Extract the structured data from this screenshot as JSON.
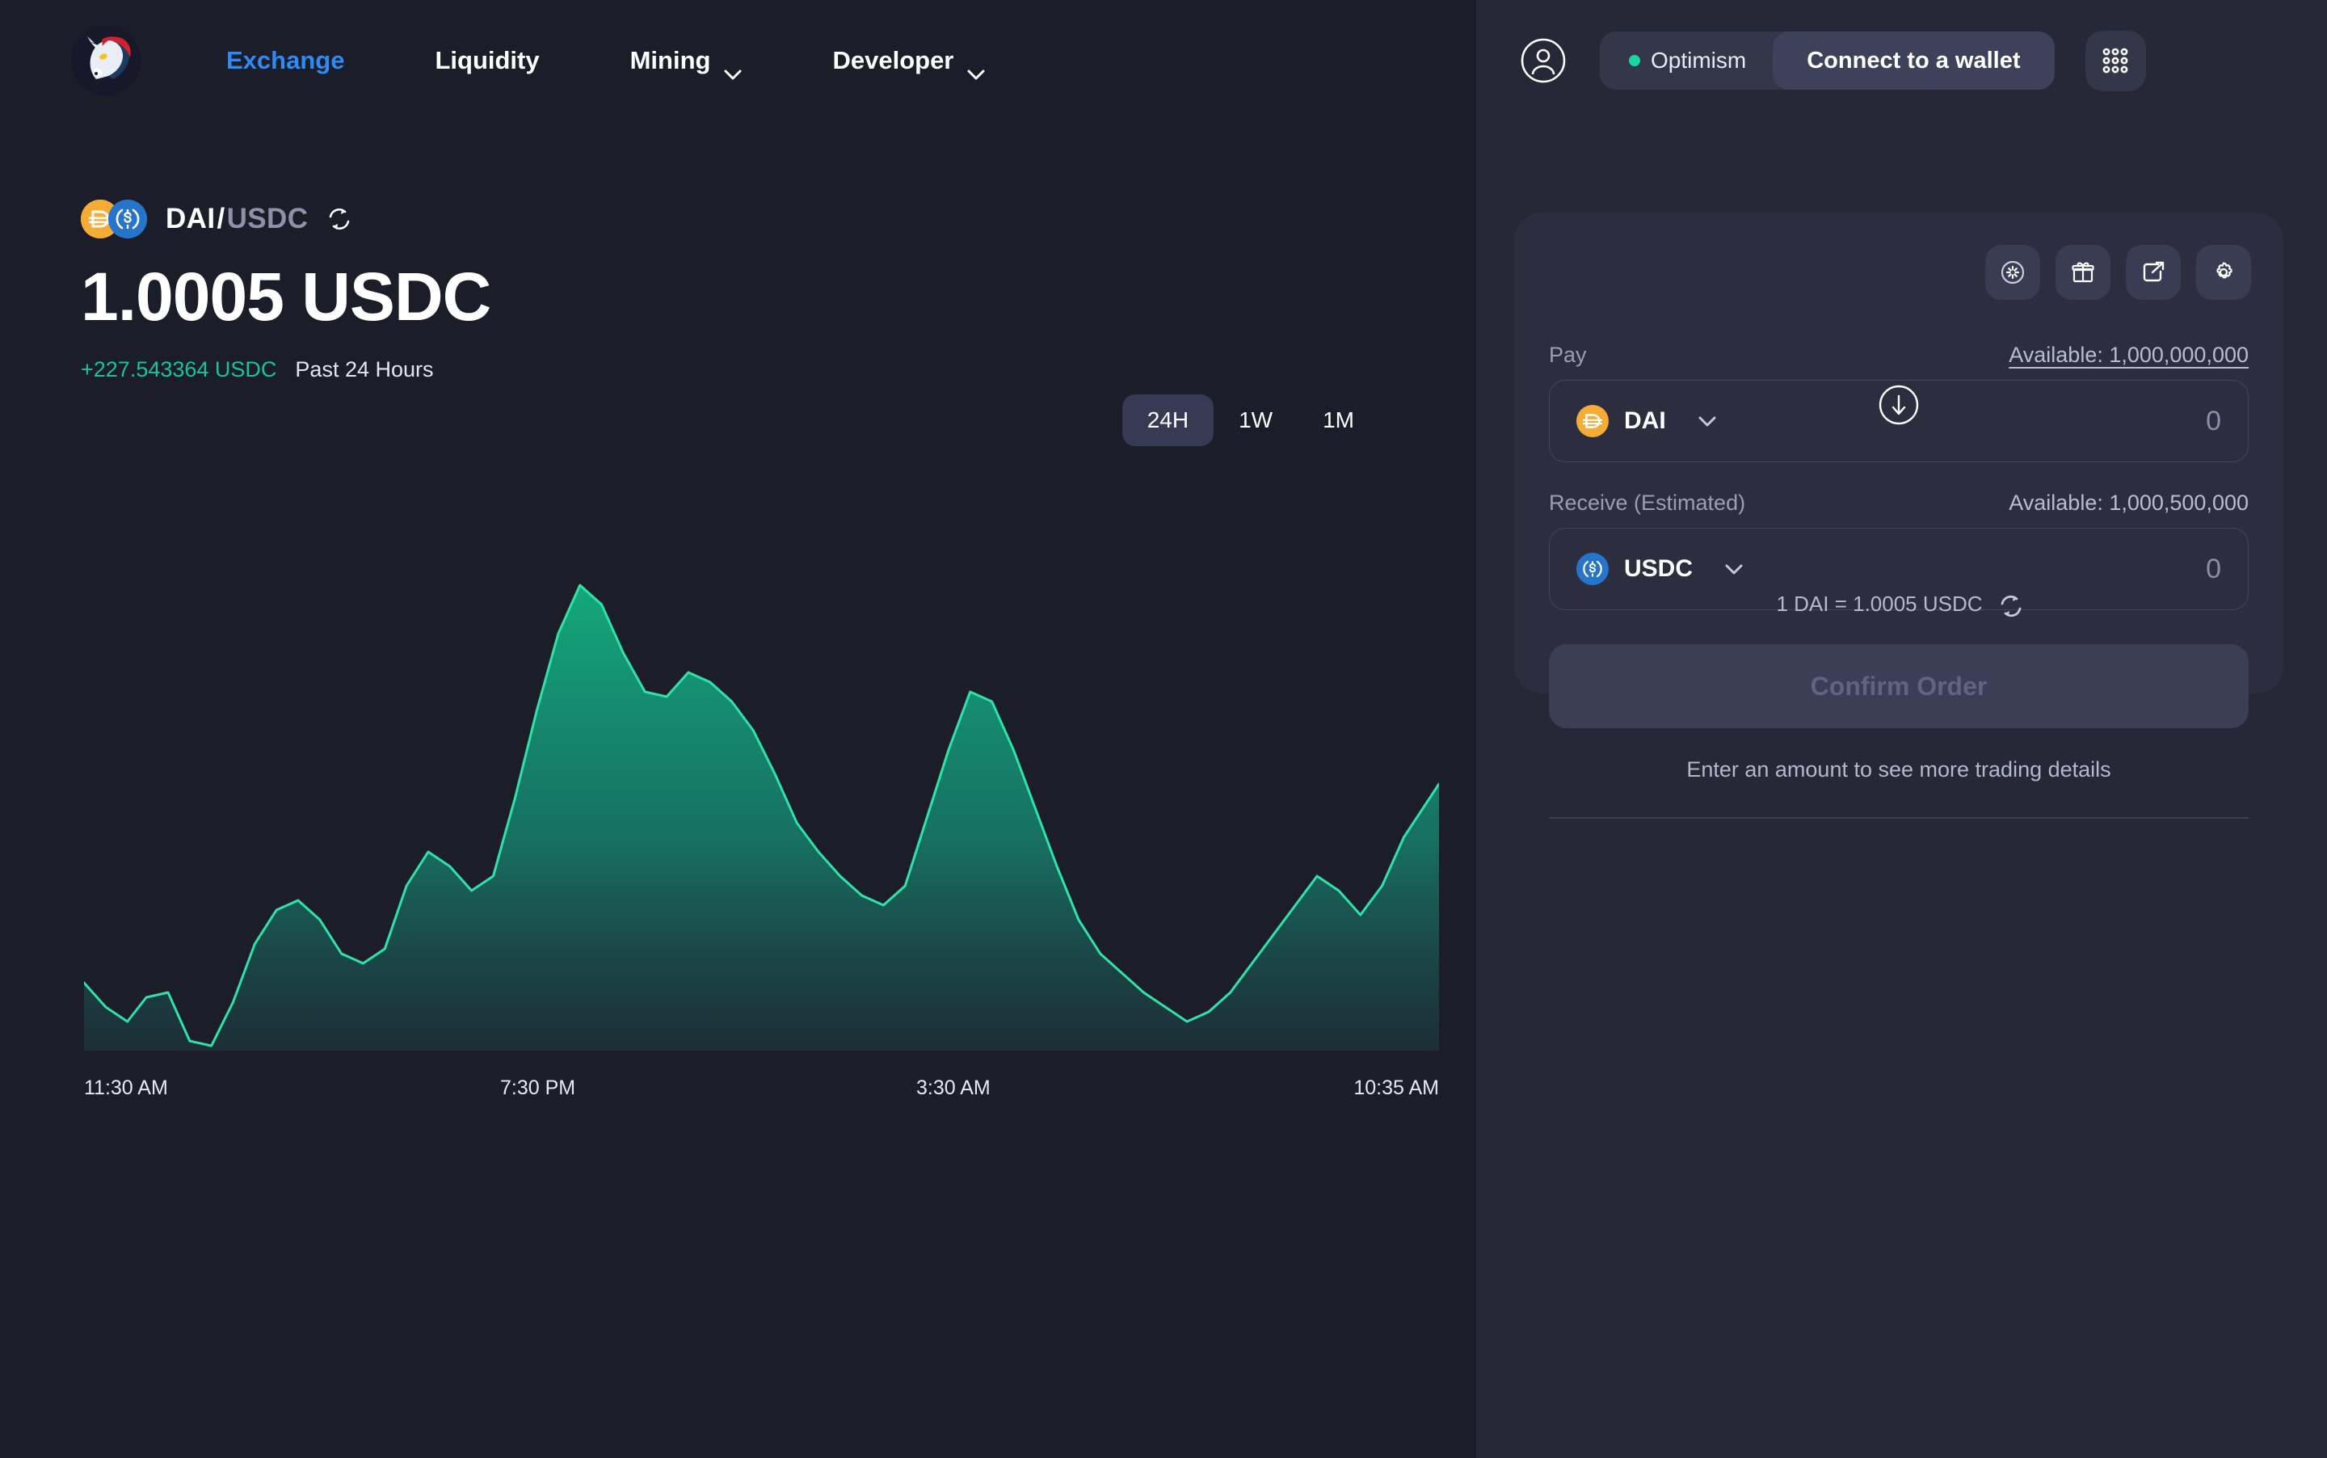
{
  "nav": {
    "logo_icon": "unicorn-logo-icon",
    "items": [
      {
        "label": "Exchange",
        "active": true,
        "has_caret": false,
        "icon": ""
      },
      {
        "label": "Liquidity",
        "active": false,
        "has_caret": false,
        "icon": ""
      },
      {
        "label": "Mining",
        "active": false,
        "has_caret": true,
        "icon": "chevron-down-icon"
      },
      {
        "label": "Developer",
        "active": false,
        "has_caret": true,
        "icon": "chevron-down-icon"
      }
    ]
  },
  "wallet": {
    "avatar_icon": "user-avatar-icon",
    "network": "Optimism",
    "network_dot_color": "#19d69e",
    "connect_label": "Connect to a wallet",
    "apps_icon": "apps-grid-icon"
  },
  "pair": {
    "base": "DAI",
    "separator": "/",
    "quote": "USDC",
    "base_color": "#f5ac37",
    "quote_color": "#2775ca",
    "swap_icon": "swap-refresh-icon",
    "price": "1.0005 USDC",
    "delta": "+227.543364 USDC",
    "delta_color": "#19c49a",
    "period": "Past 24 Hours"
  },
  "ranges": [
    {
      "label": "24H",
      "active": true
    },
    {
      "label": "1W",
      "active": false
    },
    {
      "label": "1M",
      "active": false
    }
  ],
  "chart_data": {
    "type": "area",
    "title": "DAI/USDC price",
    "xlabel": "",
    "ylabel": "",
    "grid": false,
    "legend": "none",
    "line_color": "#2fe3a8",
    "fill_top_color": "#14a87a",
    "fill_bottom_color": "#1b3d3c",
    "xlim": [
      0,
      100
    ],
    "ylim": [
      0,
      100
    ],
    "tick_labels": [
      "11:30 AM",
      "7:30 PM",
      "3:30 AM",
      "10:35 AM"
    ],
    "tick_positions": [
      0,
      34,
      65,
      96
    ],
    "x": [
      0,
      1.6,
      3.2,
      4.6,
      6.2,
      7.8,
      9.4,
      11.0,
      12.6,
      14.2,
      15.8,
      17.4,
      19.0,
      20.6,
      22.2,
      23.8,
      25.4,
      27.0,
      28.6,
      30.2,
      31.8,
      33.4,
      35.0,
      36.6,
      38.2,
      39.8,
      41.4,
      43.0,
      44.6,
      46.2,
      47.8,
      49.4,
      51.0,
      52.6,
      54.2,
      55.8,
      57.4,
      59.0,
      60.6,
      62.2,
      63.8,
      65.4,
      67.0,
      68.6,
      70.2,
      71.8,
      73.4,
      75.0,
      76.6,
      78.2,
      79.8,
      81.4,
      83.0,
      84.6,
      86.2,
      87.8,
      89.4,
      91.0,
      92.6,
      94.2,
      95.8,
      97.4,
      100
    ],
    "y": [
      14,
      9,
      6,
      11,
      12,
      2,
      1,
      10,
      22,
      29,
      31,
      27,
      20,
      18,
      21,
      34,
      41,
      38,
      33,
      36,
      52,
      70,
      86,
      96,
      92,
      82,
      74,
      73,
      78,
      76,
      72,
      66,
      57,
      47,
      41,
      36,
      32,
      30,
      34,
      48,
      62,
      74,
      72,
      62,
      50,
      38,
      27,
      20,
      16,
      12,
      9,
      6,
      8,
      12,
      18,
      24,
      30,
      36,
      33,
      28,
      34,
      44,
      55
    ],
    "values_note": "normalized 0-100 shape of the 24H price area chart"
  },
  "swap": {
    "actions": [
      {
        "icon": "oneinch-circle-icon",
        "name": "partial-fill-icon"
      },
      {
        "icon": "gift-icon",
        "name": "gift-icon"
      },
      {
        "icon": "share-icon",
        "name": "share-icon"
      },
      {
        "icon": "gear-icon",
        "name": "settings-icon"
      }
    ],
    "pay": {
      "label": "Pay",
      "available": "Available: 1,000,000,000",
      "token": "DAI",
      "token_color": "#f5ac37",
      "amount": "0",
      "chevron_icon": "chevron-down-icon"
    },
    "arrow_icon": "arrow-down-circle-icon",
    "receive": {
      "label": "Receive (Estimated)",
      "available": "Available: 1,000,500,000",
      "token": "USDC",
      "token_color": "#2775ca",
      "amount": "0",
      "chevron_icon": "chevron-down-icon"
    },
    "rate": "1 DAI = 1.0005 USDC",
    "rate_icon": "swap-refresh-icon",
    "confirm_label": "Confirm Order",
    "hint": "Enter an amount to see more trading details"
  }
}
